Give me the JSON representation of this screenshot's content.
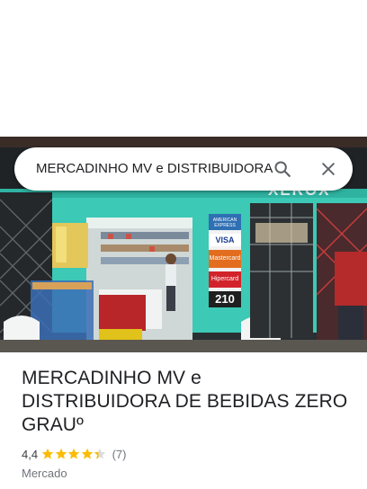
{
  "search": {
    "query": "MERCADINHO MV e DISTRIBUIDORA"
  },
  "photo": {
    "description_icon": "storefront-photo",
    "signs": {
      "american_express": "AMERICAN EXPRESS",
      "visa": "VISA",
      "mastercard": "Mastercard",
      "hipercard": "Hipercard",
      "number": "210",
      "xerox": "XEROX"
    }
  },
  "place": {
    "name": "MERCADINHO MV e DISTRIBUIDORA DE BEBIDAS ZERO GRAUº",
    "rating": "4,4",
    "rating_fraction": 0.88,
    "review_count": "(7)",
    "category": "Mercado"
  },
  "colors": {
    "star": "#fbbc04",
    "star_empty": "#dadce0",
    "text_primary": "#202124",
    "text_secondary": "#70757a",
    "wall": "#3cc9b6"
  },
  "icons": {
    "search": "search-icon",
    "close": "close-icon",
    "star": "star-icon"
  }
}
